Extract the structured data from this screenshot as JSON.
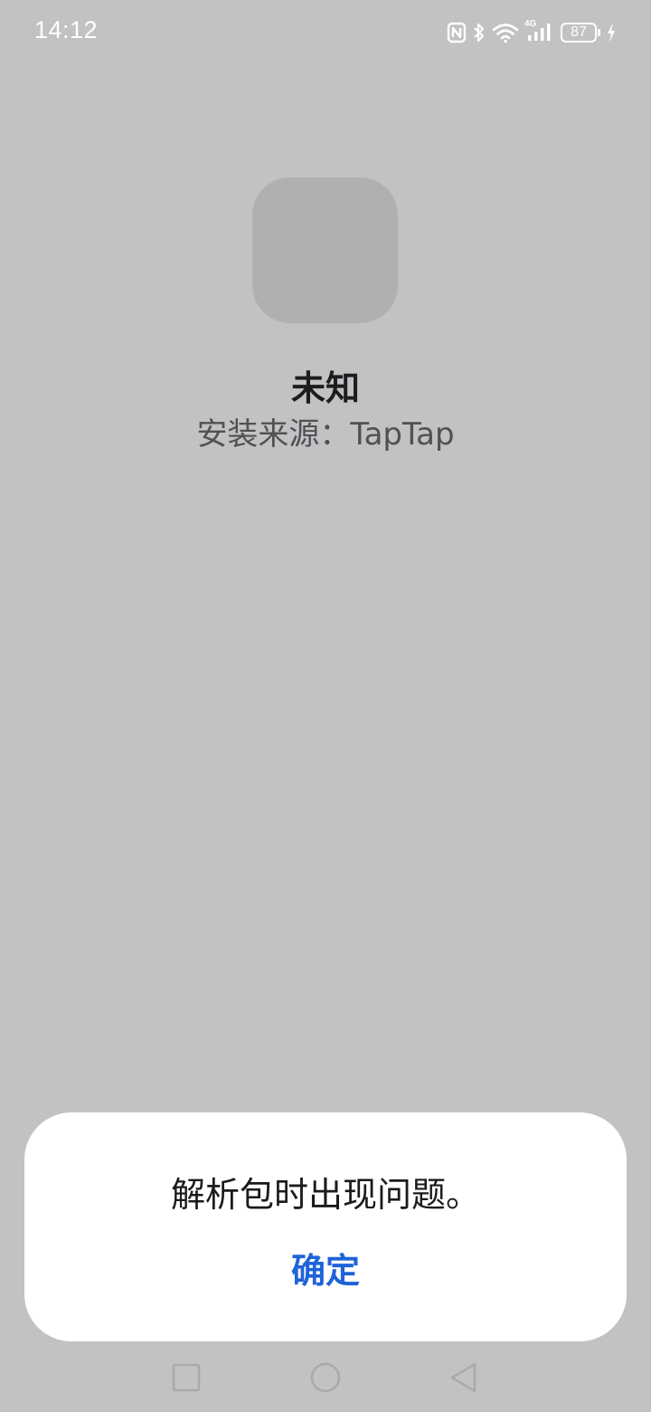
{
  "status_bar": {
    "time": "14:12",
    "battery_level": "87",
    "icons": [
      "nfc-icon",
      "bluetooth-icon",
      "wifi-icon",
      "4g-signal-icon",
      "battery-icon",
      "charging-icon"
    ],
    "network_label": "4G"
  },
  "app": {
    "name": "未知",
    "source": "安装来源：TapTap"
  },
  "dialog": {
    "message": "解析包时出现问题。",
    "confirm_label": "确定"
  },
  "nav_bar": {
    "icons": [
      "recents-icon",
      "home-icon",
      "back-icon"
    ]
  },
  "colors": {
    "background": "#c1c2c4",
    "icon_placeholder": "#afb0b2",
    "accent": "#1f63d8",
    "dialog_bg": "#ffffff"
  }
}
